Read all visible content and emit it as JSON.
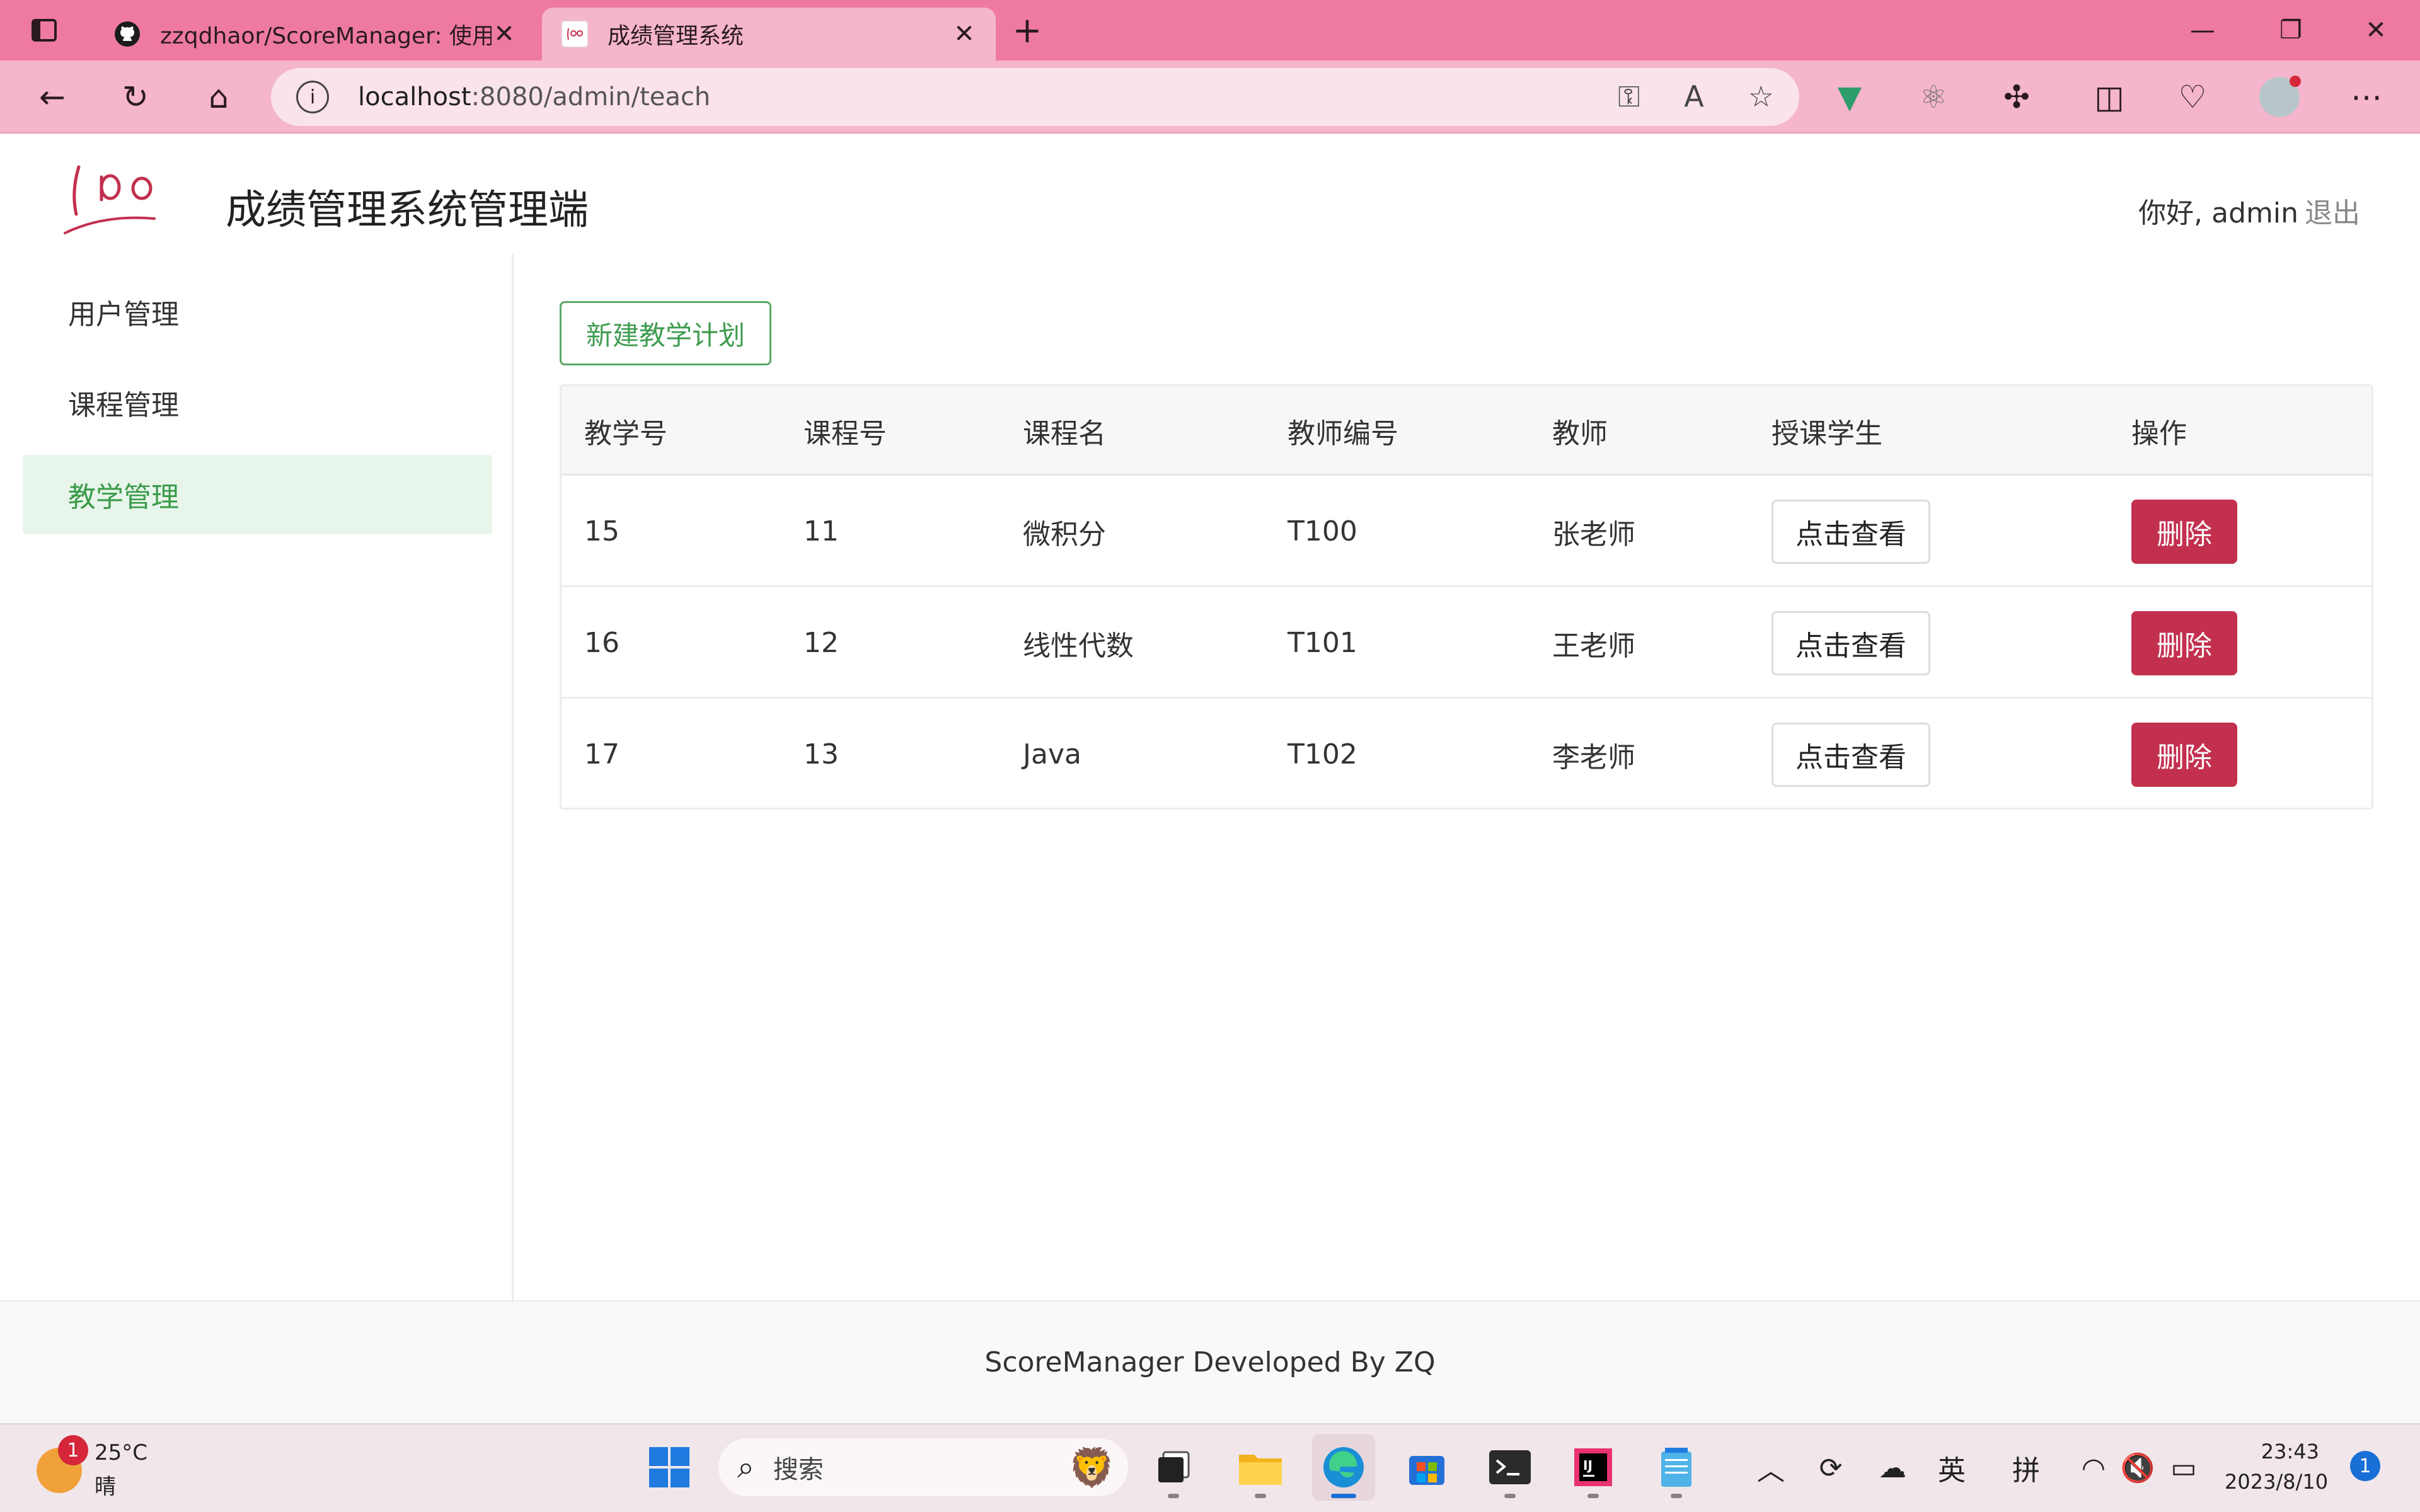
{
  "browser": {
    "tabs": [
      {
        "title": "zzqdhaor/ScoreManager: 使用Sp",
        "icon": "github-icon"
      },
      {
        "title": "成绩管理系统",
        "icon": "logo-favicon"
      }
    ],
    "address": {
      "host": "localhost",
      "path": ":8080/admin/teach"
    }
  },
  "header": {
    "title": "成绩管理系统管理端",
    "greeting": "你好, admin",
    "logout": "退出"
  },
  "sidebar": {
    "items": [
      {
        "label": "用户管理"
      },
      {
        "label": "课程管理"
      },
      {
        "label": "教学管理",
        "active": true
      }
    ]
  },
  "main": {
    "new_button": "新建教学计划",
    "columns": [
      "教学号",
      "课程号",
      "课程名",
      "教师编号",
      "教师",
      "授课学生",
      "操作"
    ],
    "rows": [
      {
        "teach_id": "15",
        "course_id": "11",
        "course_name": "微积分",
        "teacher_no": "T100",
        "teacher": "张老师",
        "view": "点击查看",
        "delete": "删除"
      },
      {
        "teach_id": "16",
        "course_id": "12",
        "course_name": "线性代数",
        "teacher_no": "T101",
        "teacher": "王老师",
        "view": "点击查看",
        "delete": "删除"
      },
      {
        "teach_id": "17",
        "course_id": "13",
        "course_name": "Java",
        "teacher_no": "T102",
        "teacher": "李老师",
        "view": "点击查看",
        "delete": "删除"
      }
    ]
  },
  "footer": {
    "text": "ScoreManager Developed By ZQ"
  },
  "taskbar": {
    "weather": {
      "temp": "25°C",
      "condition": "晴",
      "badge": "1"
    },
    "search_placeholder": "搜索",
    "tray": {
      "ime1": "英",
      "ime2": "拼"
    },
    "clock": {
      "time": "23:43",
      "date": "2023/8/10"
    },
    "notifications": "1"
  },
  "colors": {
    "accent": "#3f9c50",
    "danger": "#c3304f",
    "titlebar": "#ee7aa2",
    "toolbar": "#f5b5cc"
  }
}
